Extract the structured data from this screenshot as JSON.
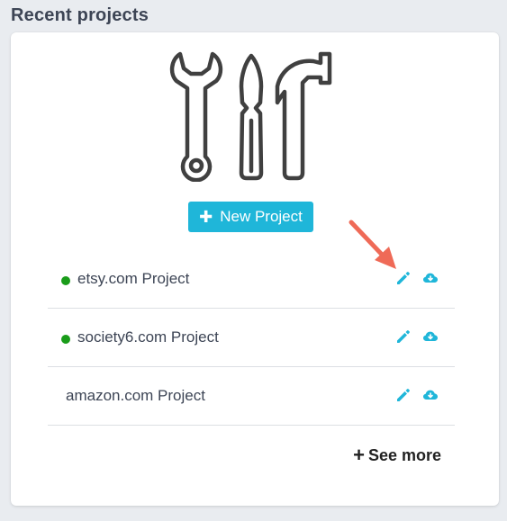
{
  "section": {
    "title": "Recent projects"
  },
  "new_project": {
    "label": "New Project",
    "icon": "plus-icon"
  },
  "projects": [
    {
      "name": "etsy.com Project",
      "status": "active",
      "status_color": "#1a9c1a",
      "actions": [
        "pencil-icon",
        "cloud-download-icon"
      ]
    },
    {
      "name": "society6.com Project",
      "status": "active",
      "status_color": "#1a9c1a",
      "actions": [
        "pencil-icon",
        "cloud-download-icon"
      ]
    },
    {
      "name": "amazon.com Project",
      "status": "none",
      "actions": [
        "pencil-icon",
        "cloud-download-icon"
      ]
    }
  ],
  "see_more": {
    "label": "See more",
    "icon": "plus-icon"
  },
  "colors": {
    "accent": "#1fb6d9",
    "annotation_arrow": "#ef6a57",
    "title": "#3d4555"
  }
}
